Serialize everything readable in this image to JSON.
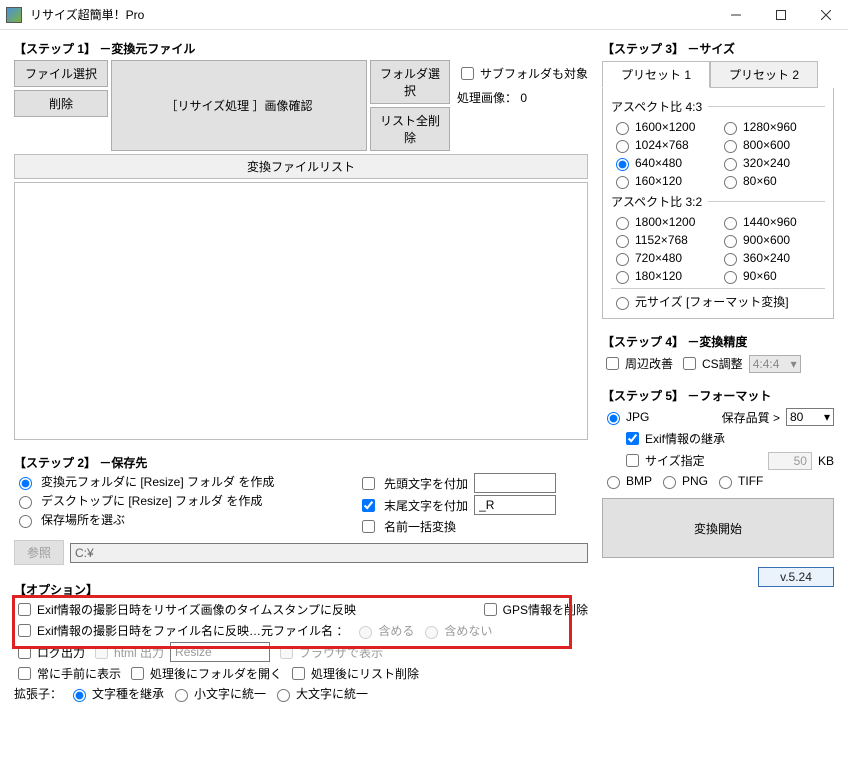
{
  "title": "リサイズ超簡単！Pro",
  "step1": {
    "heading": "【ステップ 1】 －変換元ファイル",
    "file_select": "ファイル選択",
    "delete": "削除",
    "resize_confirm": "［リサイズ処理 ］画像確認",
    "folder_select": "フォルダ選択",
    "list_delete_all": "リスト全削除",
    "subfolder": "サブフォルダも対象",
    "process_count_label": "処理画像：",
    "process_count": "0",
    "list_header": "変換ファイルリスト"
  },
  "step2": {
    "heading": "【ステップ 2】 －保存先",
    "opt_resize_in_src": "変換元フォルダに [Resize] フォルダ を作成",
    "opt_resize_desktop": "デスクトップに [Resize] フォルダ を作成",
    "opt_choose": "保存場所を選ぶ",
    "prefix": "先頭文字を付加",
    "suffix": "末尾文字を付加",
    "suffix_value": "_R",
    "rename_all": "名前一括変換",
    "browse": "参照",
    "path": "C:¥"
  },
  "options": {
    "heading": "【オプション】",
    "exif_timestamp": "Exif情報の撮影日時をリサイズ画像のタイムスタンプに反映",
    "gps_remove": "GPS情報を削除",
    "exif_filename": "Exif情報の撮影日時をファイル名に反映…元ファイル名 ：",
    "include": "含める",
    "exclude": "含めない",
    "log": "ログ出力",
    "html": "html 出力",
    "html_val": "Resize",
    "browser": "ブラウザで表示",
    "always_top": "常に手前に表示",
    "open_after": "処理後にフォルダを開く",
    "del_list_after": "処理後にリスト削除",
    "ext_label": "拡張子：",
    "ext_inherit": "文字種を継承",
    "ext_lower": "小文字に統一",
    "ext_upper": "大文字に統一"
  },
  "step3": {
    "heading": "【ステップ 3】 －サイズ",
    "tab1": "プリセット 1",
    "tab2": "プリセット 2",
    "aspect43": "アスペクト比 4:3",
    "s1600": "1600×1200",
    "s1280": "1280×960",
    "s1024": "1024×768",
    "s800": "800×600",
    "s640": "640×480",
    "s320": "320×240",
    "s160": "160×120",
    "s80": "80×60",
    "aspect32": "アスペクト比 3:2",
    "s1800": "1800×1200",
    "s1440": "1440×960",
    "s1152": "1152×768",
    "s900": "900×600",
    "s720": "720×480",
    "s360": "360×240",
    "s180": "180×120",
    "s90": "90×60",
    "original": "元サイズ [フォーマット変換]"
  },
  "step4": {
    "heading": "【ステップ 4】 －変換精度",
    "edge": "周辺改善",
    "cs": "CS調整",
    "cs_val": "4:4:4"
  },
  "step5": {
    "heading": "【ステップ 5】 －フォーマット",
    "jpg": "JPG",
    "quality_label": "保存品質 >",
    "quality": "80",
    "exif_inherit": "Exif情報の継承",
    "size_spec": "サイズ指定",
    "size_val": "50",
    "size_unit": "KB",
    "bmp": "BMP",
    "png": "PNG",
    "tiff": "TIFF",
    "start": "変換開始",
    "version": "v.5.24"
  }
}
